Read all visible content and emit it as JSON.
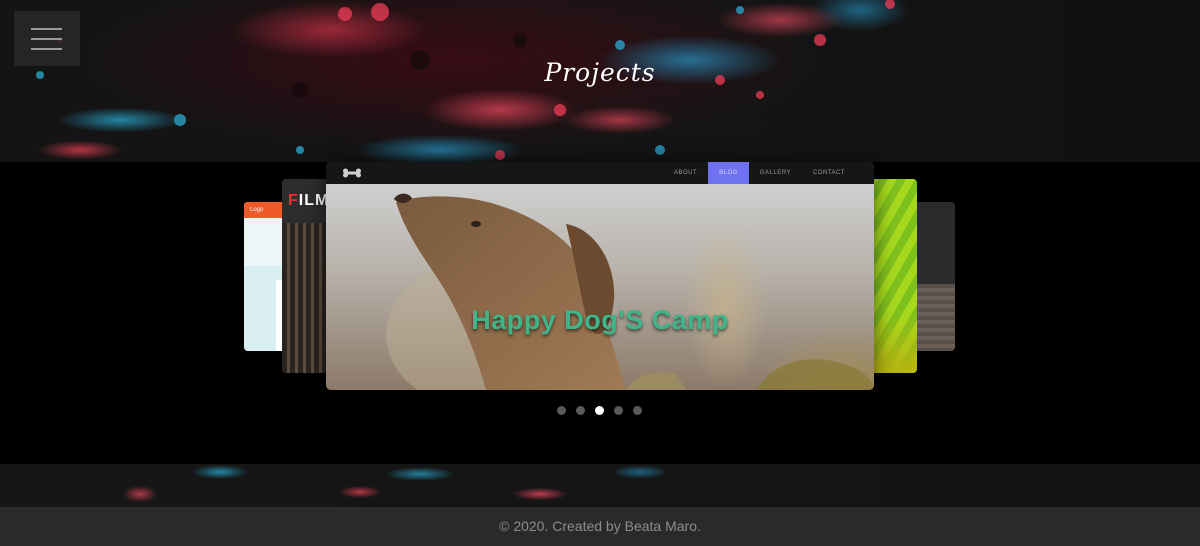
{
  "header": {
    "title": "Projects",
    "menu_icon": "hamburger-menu-icon"
  },
  "carousel": {
    "main_slide": {
      "nav_items": [
        "ABOUT",
        "BLOG",
        "GALLERY",
        "CONTACT"
      ],
      "active_nav": "BLOG",
      "logo_icon": "bone-icon",
      "caption": "Happy Dog'S Camp"
    },
    "side_slides": {
      "left_far_logo": "Logo",
      "left_title_accent": "F",
      "left_title_rest": "ILM"
    },
    "dot_count": 5,
    "active_dot_index": 2
  },
  "footer": {
    "text": "© 2020. Created by Beata Maro."
  },
  "colors": {
    "caption": "#3fb58a",
    "active_nav": "#6f72f0",
    "footer_bg": "#2a2a2a"
  }
}
